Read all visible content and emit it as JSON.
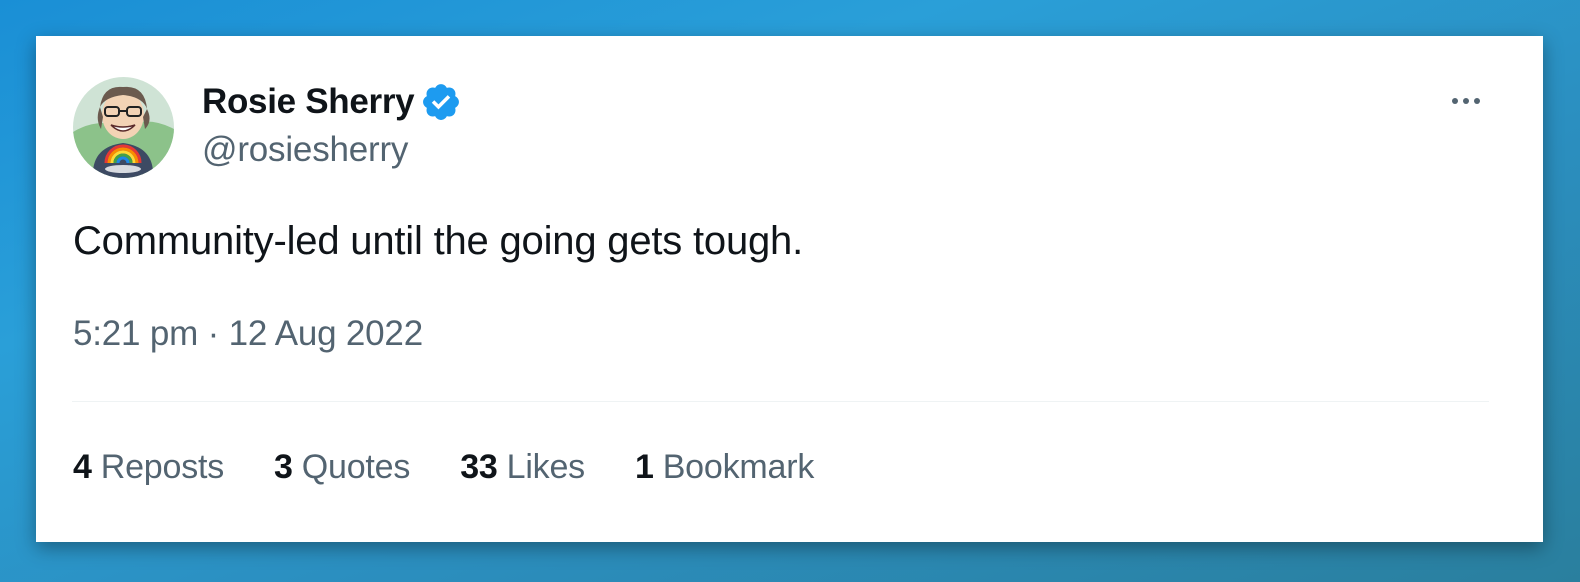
{
  "author": {
    "display_name": "Rosie Sherry",
    "handle": "@rosiesherry",
    "verified": true
  },
  "tweet": {
    "text": "Community-led until the going gets tough.",
    "timestamp": "5:21 pm · 12 Aug 2022"
  },
  "stats": [
    {
      "count": "4",
      "label": "Reposts"
    },
    {
      "count": "3",
      "label": "Quotes"
    },
    {
      "count": "33",
      "label": "Likes"
    },
    {
      "count": "1",
      "label": "Bookmark"
    }
  ],
  "colors": {
    "primary_text": "#0f1419",
    "secondary_text": "#536471",
    "verified_badge": "#1d9bf0",
    "background_gradient_start": "#1a8fd6",
    "background_gradient_end": "#2a7f9e"
  },
  "icons": {
    "verified": "verified-badge-icon",
    "more": "more-options-icon"
  }
}
